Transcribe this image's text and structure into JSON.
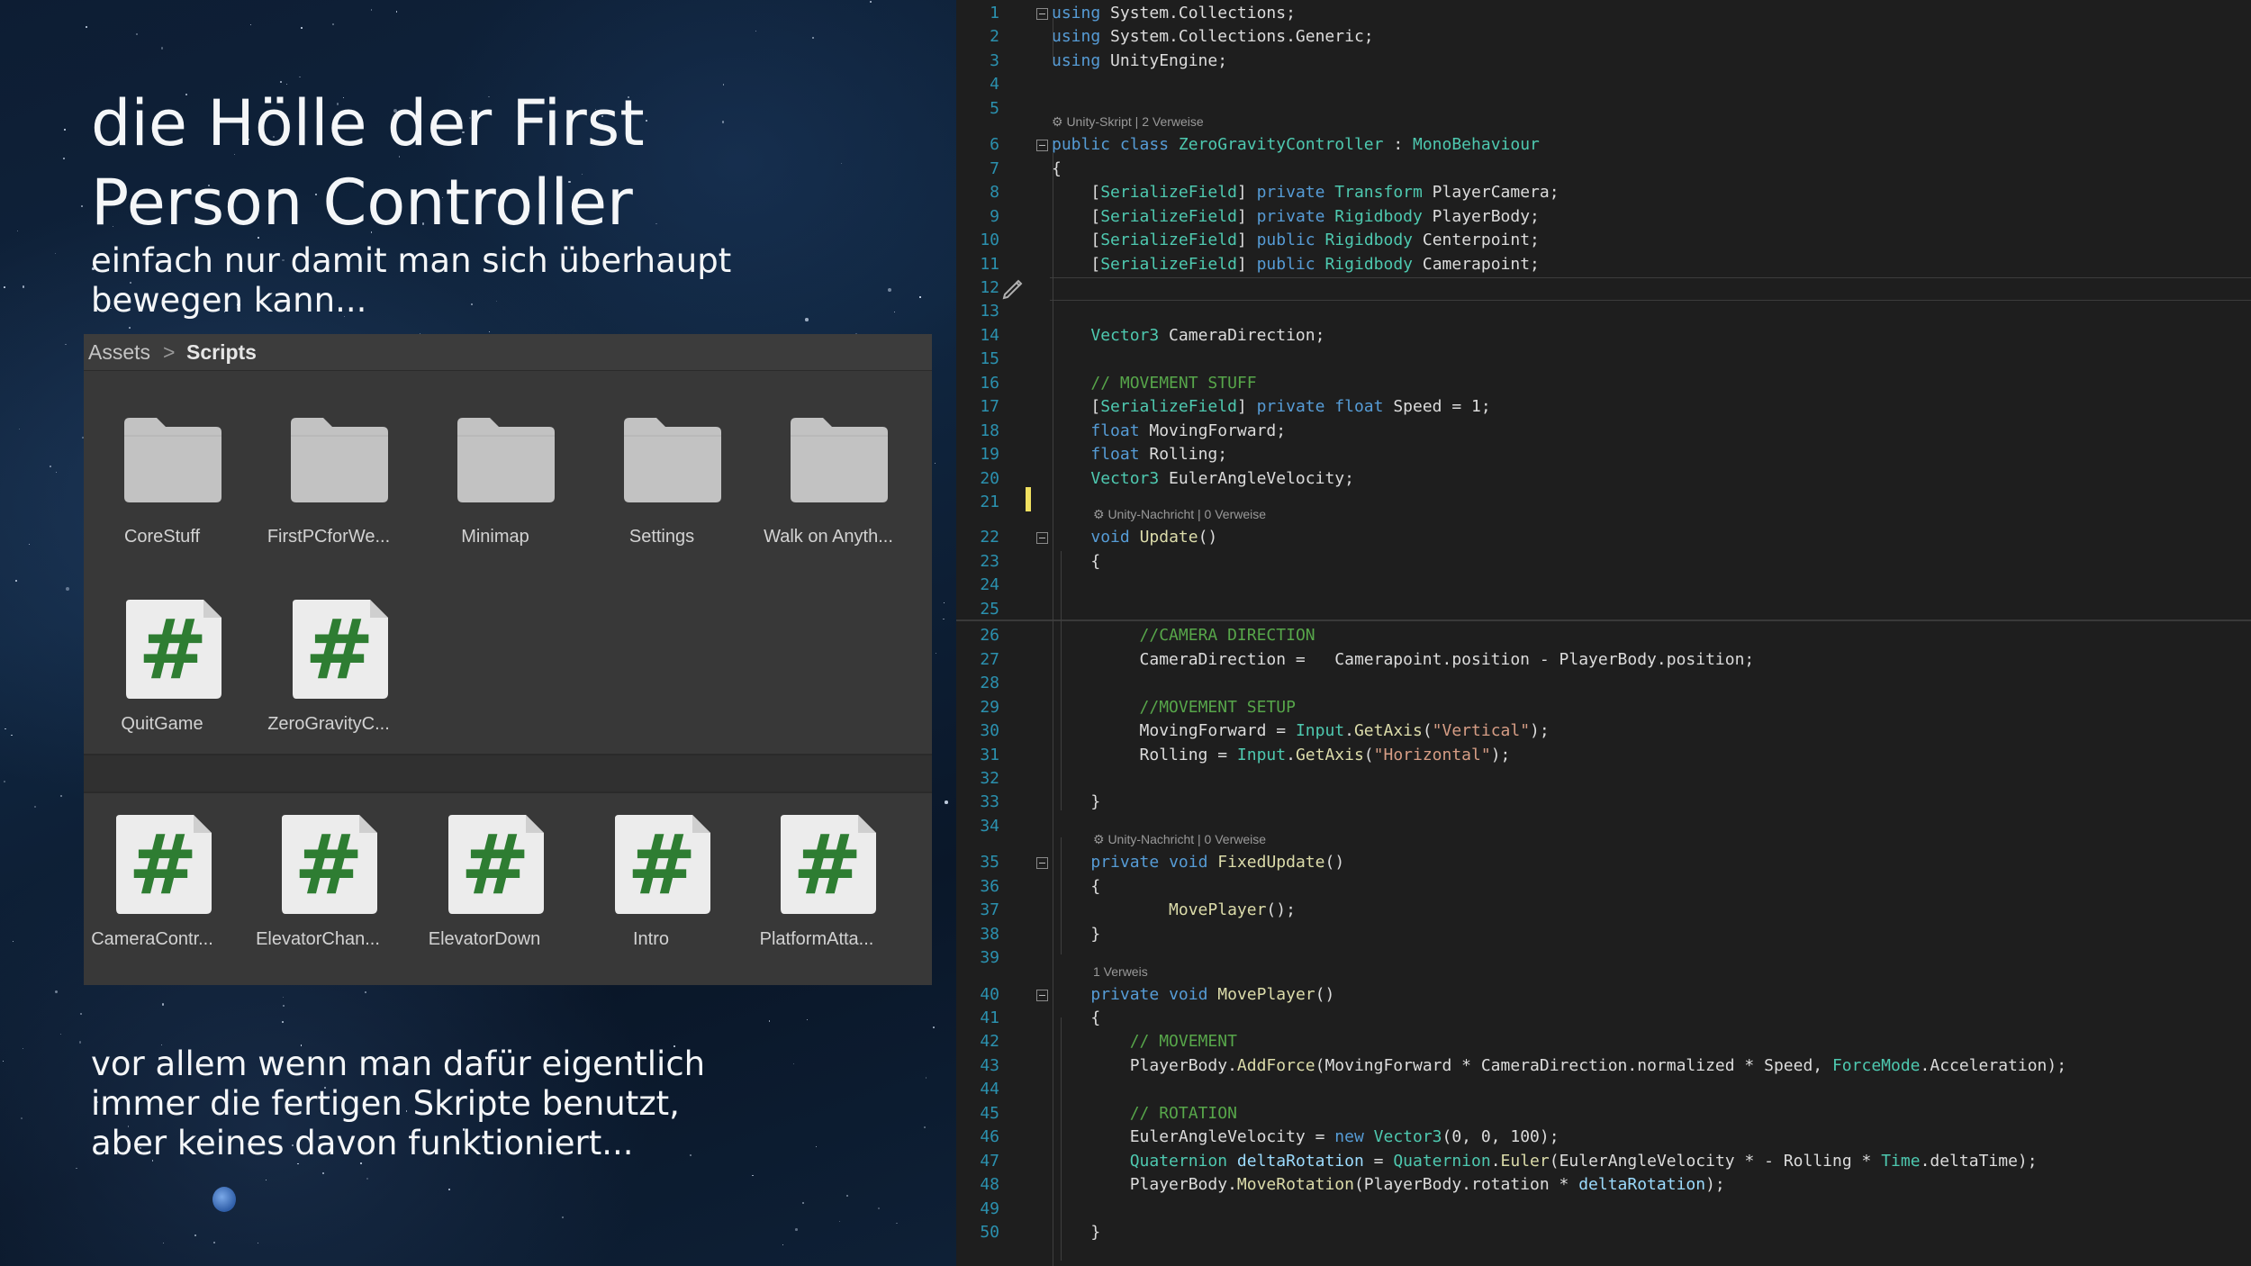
{
  "slide": {
    "title_line1": "die Hölle der First",
    "title_line2": "Person Controller",
    "subtitle_line1": "einfach nur damit man sich überhaupt",
    "subtitle_line2": "bewegen kann...",
    "footer_line1": "vor allem wenn man dafür eigentlich",
    "footer_line2": "immer die fertigen Skripte benutzt,",
    "footer_line3": "aber keines davon funktioniert..."
  },
  "project_window": {
    "breadcrumb": {
      "root": "Assets",
      "separator": ">",
      "current": "Scripts"
    },
    "top_items": [
      {
        "label": "CoreStuff",
        "icon": "folder-icon"
      },
      {
        "label": "FirstPCforWe...",
        "icon": "folder-icon"
      },
      {
        "label": "Minimap",
        "icon": "folder-icon"
      },
      {
        "label": "Settings",
        "icon": "folder-icon"
      },
      {
        "label": "Walk on Anyth...",
        "icon": "folder-icon"
      },
      {
        "label": "QuitGame",
        "icon": "csharp-script-icon"
      },
      {
        "label": "ZeroGravityC...",
        "icon": "csharp-script-icon"
      }
    ],
    "bottom_items": [
      {
        "label": "CameraContr...",
        "icon": "csharp-script-icon"
      },
      {
        "label": "ElevatorChan...",
        "icon": "csharp-script-icon"
      },
      {
        "label": "ElevatorDown",
        "icon": "csharp-script-icon"
      },
      {
        "label": "Intro",
        "icon": "csharp-script-icon"
      },
      {
        "label": "PlatformAtta...",
        "icon": "csharp-script-icon"
      }
    ],
    "script_glyph": "#",
    "colors": {
      "script_glyph": "#2e7d32",
      "panel": "#383838"
    }
  },
  "editor": {
    "colors": {
      "keyword": "#569cd6",
      "type": "#4ec9b0",
      "comment": "#57a64a",
      "method": "#dcdcaa",
      "string": "#d69d85",
      "number": "#b5cea8",
      "line_number": "#2b91af"
    },
    "codelens": [
      {
        "before_line": 6,
        "text": "Unity-Skript | 2 Verweise"
      },
      {
        "before_line": 22,
        "text": "Unity-Nachricht | 0 Verweise"
      },
      {
        "before_line": 35,
        "text": "Unity-Nachricht | 0 Verweise"
      },
      {
        "before_line": 40,
        "text": "1 Verweis"
      }
    ],
    "lines": [
      {
        "n": "1",
        "tokens": [
          [
            "kw",
            "using"
          ],
          [
            "pl",
            " System.Collections;"
          ]
        ]
      },
      {
        "n": "2",
        "tokens": [
          [
            "kw",
            "using"
          ],
          [
            "pl",
            " System.Collections.Generic;"
          ]
        ]
      },
      {
        "n": "3",
        "tokens": [
          [
            "kw",
            "using"
          ],
          [
            "pl",
            " UnityEngine;"
          ]
        ]
      },
      {
        "n": "4",
        "tokens": []
      },
      {
        "n": "5",
        "tokens": []
      },
      {
        "n": "6",
        "tokens": [
          [
            "kw",
            "public"
          ],
          [
            "pl",
            " "
          ],
          [
            "kw",
            "class"
          ],
          [
            "pl",
            " "
          ],
          [
            "ty",
            "ZeroGravityController"
          ],
          [
            "pl",
            " : "
          ],
          [
            "ty",
            "MonoBehaviour"
          ]
        ]
      },
      {
        "n": "7",
        "tokens": [
          [
            "pl",
            "{"
          ]
        ]
      },
      {
        "n": "8",
        "tokens": [
          [
            "pl",
            "    ["
          ],
          [
            "ty",
            "SerializeField"
          ],
          [
            "pl",
            "] "
          ],
          [
            "kw",
            "private"
          ],
          [
            "pl",
            " "
          ],
          [
            "ty",
            "Transform"
          ],
          [
            "pl",
            " PlayerCamera;"
          ]
        ]
      },
      {
        "n": "9",
        "tokens": [
          [
            "pl",
            "    ["
          ],
          [
            "ty",
            "SerializeField"
          ],
          [
            "pl",
            "] "
          ],
          [
            "kw",
            "private"
          ],
          [
            "pl",
            " "
          ],
          [
            "ty",
            "Rigidbody"
          ],
          [
            "pl",
            " PlayerBody;"
          ]
        ]
      },
      {
        "n": "10",
        "tokens": [
          [
            "pl",
            "    ["
          ],
          [
            "ty",
            "SerializeField"
          ],
          [
            "pl",
            "] "
          ],
          [
            "kw",
            "public"
          ],
          [
            "pl",
            " "
          ],
          [
            "ty",
            "Rigidbody"
          ],
          [
            "pl",
            " Centerpoint;"
          ]
        ]
      },
      {
        "n": "11",
        "tokens": [
          [
            "pl",
            "    ["
          ],
          [
            "ty",
            "SerializeField"
          ],
          [
            "pl",
            "] "
          ],
          [
            "kw",
            "public"
          ],
          [
            "pl",
            " "
          ],
          [
            "ty",
            "Rigidbody"
          ],
          [
            "pl",
            " Camerapoint;"
          ]
        ]
      },
      {
        "n": "12",
        "tokens": []
      },
      {
        "n": "13",
        "tokens": []
      },
      {
        "n": "14",
        "tokens": [
          [
            "pl",
            "    "
          ],
          [
            "ty",
            "Vector3"
          ],
          [
            "pl",
            " CameraDirection;"
          ]
        ]
      },
      {
        "n": "15",
        "tokens": []
      },
      {
        "n": "16",
        "tokens": [
          [
            "pl",
            "    "
          ],
          [
            "cm",
            "// MOVEMENT STUFF"
          ]
        ]
      },
      {
        "n": "17",
        "tokens": [
          [
            "pl",
            "    ["
          ],
          [
            "ty",
            "SerializeField"
          ],
          [
            "pl",
            "] "
          ],
          [
            "kw",
            "private"
          ],
          [
            "pl",
            " "
          ],
          [
            "kw",
            "float"
          ],
          [
            "pl",
            " Speed = 1;"
          ]
        ]
      },
      {
        "n": "18",
        "tokens": [
          [
            "pl",
            "    "
          ],
          [
            "kw",
            "float"
          ],
          [
            "pl",
            " MovingForward;"
          ]
        ]
      },
      {
        "n": "19",
        "tokens": [
          [
            "pl",
            "    "
          ],
          [
            "kw",
            "float"
          ],
          [
            "pl",
            " Rolling;"
          ]
        ]
      },
      {
        "n": "20",
        "tokens": [
          [
            "pl",
            "    "
          ],
          [
            "ty",
            "Vector3"
          ],
          [
            "pl",
            " EulerAngleVelocity;"
          ]
        ]
      },
      {
        "n": "21",
        "tokens": []
      },
      {
        "n": "22",
        "tokens": [
          [
            "pl",
            "    "
          ],
          [
            "kw",
            "void"
          ],
          [
            "pl",
            " "
          ],
          [
            "fn",
            "Update"
          ],
          [
            "pl",
            "()"
          ]
        ]
      },
      {
        "n": "23",
        "tokens": [
          [
            "pl",
            "    {"
          ]
        ]
      },
      {
        "n": "24",
        "tokens": []
      },
      {
        "n": "25",
        "tokens": []
      },
      {
        "n": "26",
        "tokens": [
          [
            "pl",
            "         "
          ],
          [
            "cm",
            "//CAMERA DIRECTION"
          ]
        ]
      },
      {
        "n": "27",
        "tokens": [
          [
            "pl",
            "         CameraDirection =   Camerapoint.position - PlayerBody.position;"
          ]
        ]
      },
      {
        "n": "28",
        "tokens": []
      },
      {
        "n": "29",
        "tokens": [
          [
            "pl",
            "         "
          ],
          [
            "cm",
            "//MOVEMENT SETUP"
          ]
        ]
      },
      {
        "n": "30",
        "tokens": [
          [
            "pl",
            "         MovingForward = "
          ],
          [
            "ty",
            "Input"
          ],
          [
            "pl",
            "."
          ],
          [
            "fn",
            "GetAxis"
          ],
          [
            "pl",
            "("
          ],
          [
            "st",
            "\"Vertical\""
          ],
          [
            "pl",
            ");"
          ]
        ]
      },
      {
        "n": "31",
        "tokens": [
          [
            "pl",
            "         Rolling = "
          ],
          [
            "ty",
            "Input"
          ],
          [
            "pl",
            "."
          ],
          [
            "fn",
            "GetAxis"
          ],
          [
            "pl",
            "("
          ],
          [
            "st",
            "\"Horizontal\""
          ],
          [
            "pl",
            ");"
          ]
        ]
      },
      {
        "n": "32",
        "tokens": []
      },
      {
        "n": "33",
        "tokens": [
          [
            "pl",
            "    }"
          ]
        ]
      },
      {
        "n": "34",
        "tokens": []
      },
      {
        "n": "35",
        "tokens": [
          [
            "pl",
            "    "
          ],
          [
            "kw",
            "private"
          ],
          [
            "pl",
            " "
          ],
          [
            "kw",
            "void"
          ],
          [
            "pl",
            " "
          ],
          [
            "fn",
            "FixedUpdate"
          ],
          [
            "pl",
            "()"
          ]
        ]
      },
      {
        "n": "36",
        "tokens": [
          [
            "pl",
            "    {"
          ]
        ]
      },
      {
        "n": "37",
        "tokens": [
          [
            "pl",
            "            "
          ],
          [
            "fn",
            "MovePlayer"
          ],
          [
            "pl",
            "();"
          ]
        ]
      },
      {
        "n": "38",
        "tokens": [
          [
            "pl",
            "    }"
          ]
        ]
      },
      {
        "n": "39",
        "tokens": []
      },
      {
        "n": "40",
        "tokens": [
          [
            "pl",
            "    "
          ],
          [
            "kw",
            "private"
          ],
          [
            "pl",
            " "
          ],
          [
            "kw",
            "void"
          ],
          [
            "pl",
            " "
          ],
          [
            "fn",
            "MovePlayer"
          ],
          [
            "pl",
            "()"
          ]
        ]
      },
      {
        "n": "41",
        "tokens": [
          [
            "pl",
            "    {"
          ]
        ]
      },
      {
        "n": "42",
        "tokens": [
          [
            "pl",
            "        "
          ],
          [
            "cm",
            "// MOVEMENT"
          ]
        ]
      },
      {
        "n": "43",
        "tokens": [
          [
            "pl",
            "        PlayerBody."
          ],
          [
            "fn",
            "AddForce"
          ],
          [
            "pl",
            "(MovingForward * CameraDirection.normalized * Speed, "
          ],
          [
            "ty",
            "ForceMode"
          ],
          [
            "pl",
            ".Acceleration);"
          ]
        ]
      },
      {
        "n": "44",
        "tokens": []
      },
      {
        "n": "45",
        "tokens": [
          [
            "pl",
            "        "
          ],
          [
            "cm",
            "// ROTATION"
          ]
        ]
      },
      {
        "n": "46",
        "tokens": [
          [
            "pl",
            "        EulerAngleVelocity = "
          ],
          [
            "kw",
            "new"
          ],
          [
            "pl",
            " "
          ],
          [
            "ty",
            "Vector3"
          ],
          [
            "pl",
            "(0, 0, 100);"
          ]
        ]
      },
      {
        "n": "47",
        "tokens": [
          [
            "pl",
            "        "
          ],
          [
            "ty",
            "Quaternion"
          ],
          [
            "pl",
            " "
          ],
          [
            "vr",
            "deltaRotation"
          ],
          [
            "pl",
            " = "
          ],
          [
            "ty",
            "Quaternion"
          ],
          [
            "pl",
            "."
          ],
          [
            "fn",
            "Euler"
          ],
          [
            "pl",
            "(EulerAngleVelocity * - Rolling * "
          ],
          [
            "ty",
            "Time"
          ],
          [
            "pl",
            ".deltaTime);"
          ]
        ]
      },
      {
        "n": "48",
        "tokens": [
          [
            "pl",
            "        PlayerBody."
          ],
          [
            "fn",
            "MoveRotation"
          ],
          [
            "pl",
            "(PlayerBody.rotation * "
          ],
          [
            "vr",
            "deltaRotation"
          ],
          [
            "pl",
            ");"
          ]
        ]
      },
      {
        "n": "49",
        "tokens": []
      },
      {
        "n": "50",
        "tokens": [
          [
            "pl",
            "    }"
          ]
        ]
      }
    ]
  }
}
